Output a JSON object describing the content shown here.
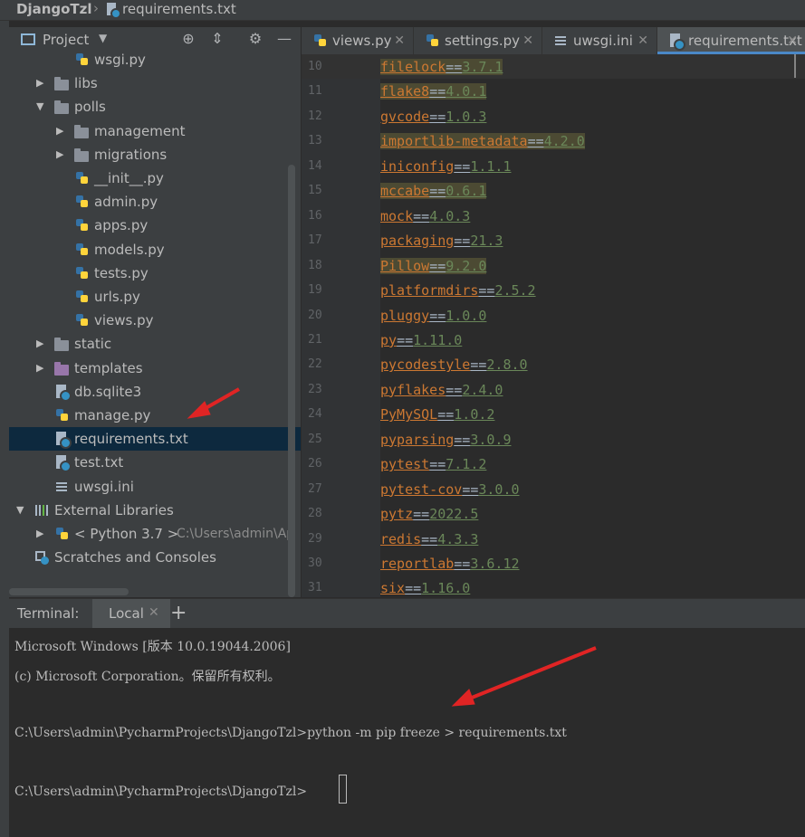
{
  "breadcrumb": {
    "project": "DjangoTzl",
    "file": "requirements.txt"
  },
  "project_panel": {
    "title": "Project",
    "tree": [
      {
        "label": "wsgi.py",
        "type": "py",
        "indent": 3
      },
      {
        "label": "libs",
        "type": "folder",
        "indent": 2,
        "expanded": false
      },
      {
        "label": "polls",
        "type": "folder",
        "indent": 2,
        "expanded": true
      },
      {
        "label": "management",
        "type": "folder",
        "indent": 3,
        "expanded": false
      },
      {
        "label": "migrations",
        "type": "folder",
        "indent": 3,
        "expanded": false
      },
      {
        "label": "__init__.py",
        "type": "py",
        "indent": 3
      },
      {
        "label": "admin.py",
        "type": "py",
        "indent": 3
      },
      {
        "label": "apps.py",
        "type": "py",
        "indent": 3
      },
      {
        "label": "models.py",
        "type": "py",
        "indent": 3
      },
      {
        "label": "tests.py",
        "type": "py",
        "indent": 3
      },
      {
        "label": "urls.py",
        "type": "py",
        "indent": 3
      },
      {
        "label": "views.py",
        "type": "py",
        "indent": 3
      },
      {
        "label": "static",
        "type": "folder",
        "indent": 2,
        "expanded": false
      },
      {
        "label": "templates",
        "type": "folder-purple",
        "indent": 2,
        "expanded": false
      },
      {
        "label": "db.sqlite3",
        "type": "txt",
        "indent": 2
      },
      {
        "label": "manage.py",
        "type": "py",
        "indent": 2
      },
      {
        "label": "requirements.txt",
        "type": "txt",
        "indent": 2,
        "selected": true
      },
      {
        "label": "test.txt",
        "type": "txt",
        "indent": 2
      },
      {
        "label": "uwsgi.ini",
        "type": "ini",
        "indent": 2
      },
      {
        "label": "External Libraries",
        "type": "lib",
        "indent": 1,
        "expanded": true
      },
      {
        "label": "< Python 3.7 >",
        "type": "python",
        "indent": 2,
        "expanded": false,
        "hint": "C:\\Users\\admin\\Ap"
      },
      {
        "label": "Scratches and Consoles",
        "type": "scratch",
        "indent": 1
      }
    ]
  },
  "editor_tabs": [
    {
      "label": "views.py",
      "icon": "python-file-icon",
      "active": false
    },
    {
      "label": "settings.py",
      "icon": "python-file-icon",
      "active": false
    },
    {
      "label": "uwsgi.ini",
      "icon": "ini-file-icon",
      "active": false
    },
    {
      "label": "requirements.txt",
      "icon": "text-file-icon",
      "active": true
    }
  ],
  "editor_lines": [
    {
      "num": "10",
      "pkg": "filelock",
      "ver": "3.7.1",
      "highlight": true
    },
    {
      "num": "11",
      "pkg": "flake8",
      "ver": "4.0.1",
      "highlight": true
    },
    {
      "num": "12",
      "pkg": "gvcode",
      "ver": "1.0.3",
      "highlight": false
    },
    {
      "num": "13",
      "pkg": "importlib-metadata",
      "ver": "4.2.0",
      "highlight": true
    },
    {
      "num": "14",
      "pkg": "iniconfig",
      "ver": "1.1.1",
      "highlight": false
    },
    {
      "num": "15",
      "pkg": "mccabe",
      "ver": "0.6.1",
      "highlight": true
    },
    {
      "num": "16",
      "pkg": "mock",
      "ver": "4.0.3",
      "highlight": false
    },
    {
      "num": "17",
      "pkg": "packaging",
      "ver": "21.3",
      "highlight": false
    },
    {
      "num": "18",
      "pkg": "Pillow",
      "ver": "9.2.0",
      "highlight": true
    },
    {
      "num": "19",
      "pkg": "platformdirs",
      "ver": "2.5.2",
      "highlight": false
    },
    {
      "num": "20",
      "pkg": "pluggy",
      "ver": "1.0.0",
      "highlight": false
    },
    {
      "num": "21",
      "pkg": "py",
      "ver": "1.11.0",
      "highlight": false
    },
    {
      "num": "22",
      "pkg": "pycodestyle",
      "ver": "2.8.0",
      "highlight": false
    },
    {
      "num": "23",
      "pkg": "pyflakes",
      "ver": "2.4.0",
      "highlight": false
    },
    {
      "num": "24",
      "pkg": "PyMySQL",
      "ver": "1.0.2",
      "highlight": false
    },
    {
      "num": "25",
      "pkg": "pyparsing",
      "ver": "3.0.9",
      "highlight": false
    },
    {
      "num": "26",
      "pkg": "pytest",
      "ver": "7.1.2",
      "highlight": false
    },
    {
      "num": "27",
      "pkg": "pytest-cov",
      "ver": "3.0.0",
      "highlight": false
    },
    {
      "num": "28",
      "pkg": "pytz",
      "ver": "2022.5",
      "highlight": false
    },
    {
      "num": "29",
      "pkg": "redis",
      "ver": "4.3.3",
      "highlight": false
    },
    {
      "num": "30",
      "pkg": "reportlab",
      "ver": "3.6.12",
      "highlight": false
    },
    {
      "num": "31",
      "pkg": "six",
      "ver": "1.16.0",
      "highlight": false
    }
  ],
  "terminal": {
    "label": "Terminal:",
    "tab": "Local",
    "lines": [
      "Microsoft Windows [版本 10.0.19044.2006]",
      "(c) Microsoft Corporation。保留所有权利。",
      "",
      "C:\\Users\\admin\\PycharmProjects\\DjangoTzl>python -m pip freeze > requirements.txt",
      "",
      "C:\\Users\\admin\\PycharmProjects\\DjangoTzl>"
    ]
  },
  "colors": {
    "accent": "#4a88c7",
    "selection": "#0d293e",
    "annotation_arrow": "#e02424",
    "package_name": "#cc7832",
    "version": "#6a8759"
  }
}
